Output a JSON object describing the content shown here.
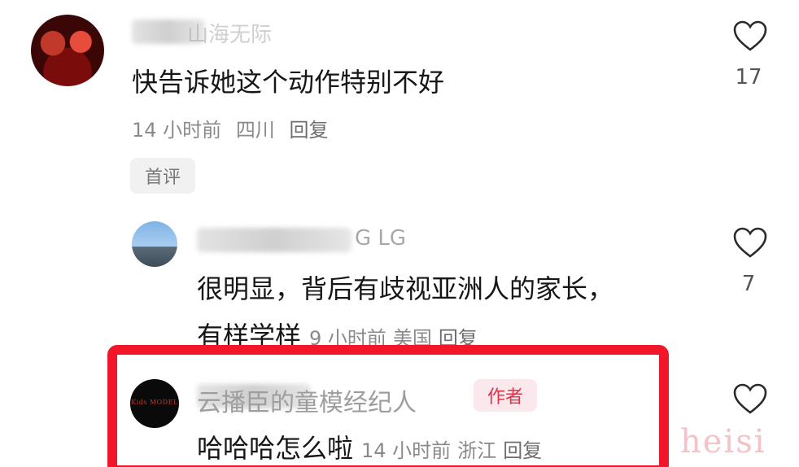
{
  "comments": [
    {
      "username": "山海无际",
      "text": "快告诉她这个动作特别不好",
      "time": "14 小时前",
      "location": "四川",
      "reply": "回复",
      "tag": "首评",
      "likes": "17"
    },
    {
      "username": "G LG",
      "text_line1": "很明显，背后有歧视亚洲人的家长，",
      "text_line2": "有样学样",
      "time": "9 小时前",
      "location": "美国",
      "reply": "回复",
      "likes": "7"
    },
    {
      "username": "云播臣的童模经纪人",
      "badge": "作者",
      "avatar_text": "Kids MODEL",
      "text": "哈哈哈怎么啦",
      "time": "14 小时前",
      "location": "浙江",
      "reply": "回复"
    }
  ],
  "watermark": "heisi",
  "colors": {
    "highlight": "#f2162a",
    "author_badge": "#e0314b"
  },
  "icons": {
    "like": "heart-outline-icon"
  }
}
